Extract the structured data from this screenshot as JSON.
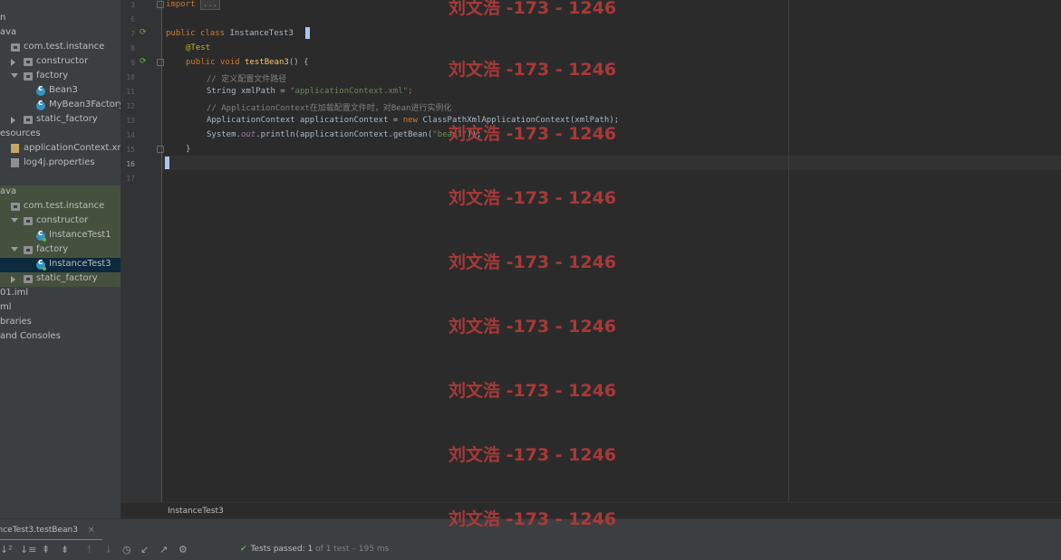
{
  "project_tree": {
    "rows": [
      {
        "label": "n",
        "indent": -4,
        "arrow": "none",
        "icon": "none"
      },
      {
        "label": "ava",
        "indent": -4,
        "arrow": "none",
        "icon": "none"
      },
      {
        "label": "com.test.instance",
        "indent": 0,
        "arrow": "none",
        "icon": "package-icon"
      },
      {
        "label": "constructor",
        "indent": 1,
        "arrow": "right",
        "icon": "package-icon"
      },
      {
        "label": "factory",
        "indent": 1,
        "arrow": "down",
        "icon": "package-icon"
      },
      {
        "label": "Bean3",
        "indent": 2,
        "arrow": "none",
        "icon": "class-icon"
      },
      {
        "label": "MyBean3Factory",
        "indent": 2,
        "arrow": "none",
        "icon": "class-icon"
      },
      {
        "label": "static_factory",
        "indent": 1,
        "arrow": "right",
        "icon": "package-icon"
      },
      {
        "label": "esources",
        "indent": -4,
        "arrow": "none",
        "icon": "none"
      },
      {
        "label": "applicationContext.xml",
        "indent": 0,
        "arrow": "none",
        "icon": "xml-file-icon"
      },
      {
        "label": "log4j.properties",
        "indent": 0,
        "arrow": "none",
        "icon": "properties-file-icon"
      },
      {
        "label": "",
        "indent": 0,
        "arrow": "none",
        "icon": "none"
      },
      {
        "label": "ava",
        "indent": -4,
        "arrow": "none",
        "icon": "none",
        "style": "green"
      },
      {
        "label": "com.test.instance",
        "indent": 0,
        "arrow": "none",
        "icon": "package-icon",
        "style": "green"
      },
      {
        "label": "constructor",
        "indent": 1,
        "arrow": "down",
        "icon": "package-icon",
        "style": "green"
      },
      {
        "label": "InstanceTest1",
        "indent": 2,
        "arrow": "none",
        "icon": "test-class-icon",
        "style": "green"
      },
      {
        "label": "factory",
        "indent": 1,
        "arrow": "down",
        "icon": "package-icon",
        "style": "green"
      },
      {
        "label": "InstanceTest3",
        "indent": 2,
        "arrow": "none",
        "icon": "test-class-icon",
        "style": "selected"
      },
      {
        "label": "static_factory",
        "indent": 1,
        "arrow": "right",
        "icon": "package-icon",
        "style": "green"
      },
      {
        "label": "01.iml",
        "indent": -4,
        "arrow": "none",
        "icon": "none"
      },
      {
        "label": "ml",
        "indent": -4,
        "arrow": "none",
        "icon": "none"
      },
      {
        "label": "braries",
        "indent": -4,
        "arrow": "none",
        "icon": "none"
      },
      {
        "label": "and Consoles",
        "indent": -4,
        "arrow": "none",
        "icon": "none"
      }
    ]
  },
  "editor": {
    "line_numbers": [
      "3",
      "6",
      "7",
      "8",
      "9",
      "10",
      "11",
      "12",
      "13",
      "14",
      "15",
      "16",
      "17"
    ],
    "lines": {
      "l3_import": "import",
      "l3_collapsed": "...",
      "l7_kw": "public class ",
      "l7_name": "InstanceTest3",
      "l8_ann": "@Test",
      "l9_kw": "public void ",
      "l9_fn": "testBean3",
      "l9_rest": "() {",
      "l10_cmt": "// 定义配置文件路径",
      "l11_type": "String xmlPath = ",
      "l11_str": "\"applicationContext.xml\"",
      "l11_end": ";",
      "l12_cmt": "// ApplicationContext在加载配置文件时，对Bean进行实例化",
      "l13_a": "ApplicationContext applicationContext = ",
      "l13_kw": "new ",
      "l13_b": "ClassPathXmlApplicationContext(xmlPath);",
      "l14_a": "System.",
      "l14_fld": "out",
      "l14_b": ".println(applicationContext.getBean(",
      "l14_str": "\"bean3\"",
      "l14_c": "));",
      "l15_brace": "}"
    }
  },
  "breadcrumb": {
    "label": "InstanceTest3"
  },
  "run_panel": {
    "tab_label": "anceTest3.testBean3",
    "close": "×",
    "status_check": "✔",
    "status_main": "Tests passed: ",
    "status_count": "1",
    "status_rest": " of 1 test – 195 ms"
  },
  "toolbar": {
    "icons": [
      "sort-alpha-icon",
      "sort-duration-icon",
      "expand-all-icon",
      "collapse-all-icon",
      "previous-failed-icon",
      "next-failed-icon",
      "history-icon",
      "import-tests-icon",
      "export-tests-icon",
      "settings-gear-icon"
    ]
  },
  "watermark": {
    "text": "刘文浩 -173 - 1246"
  },
  "colors": {
    "accent": "#4a88c7",
    "passed": "#5eaa48",
    "watermark": "#b43a3a"
  }
}
